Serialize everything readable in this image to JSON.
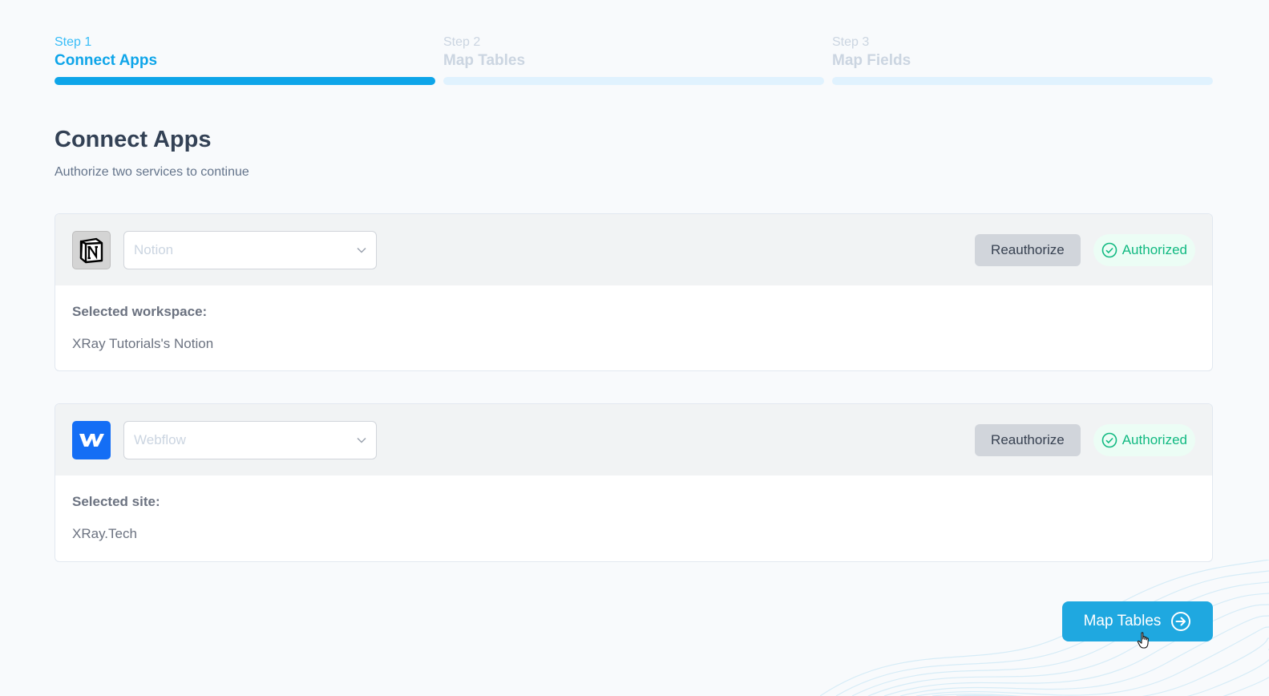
{
  "stepper": {
    "steps": [
      {
        "number": "Step 1",
        "title": "Connect Apps",
        "active": true
      },
      {
        "number": "Step 2",
        "title": "Map Tables",
        "active": false
      },
      {
        "number": "Step 3",
        "title": "Map Fields",
        "active": false
      }
    ]
  },
  "header": {
    "title": "Connect Apps",
    "subtitle": "Authorize two services to continue"
  },
  "apps": [
    {
      "icon": "notion-logo-icon",
      "placeholder": "Notion",
      "reauthorize_label": "Reauthorize",
      "status_label": "Authorized",
      "field_label": "Selected workspace:",
      "field_value": "XRay Tutorials's Notion"
    },
    {
      "icon": "webflow-logo-icon",
      "placeholder": "Webflow",
      "reauthorize_label": "Reauthorize",
      "status_label": "Authorized",
      "field_label": "Selected site:",
      "field_value": "XRay.Tech"
    }
  ],
  "footer": {
    "next_label": "Map Tables",
    "next_icon": "arrow-right-circle-icon"
  },
  "colors": {
    "accent": "#0ea5e9",
    "success": "#10b981",
    "button": "#1fa8e0"
  }
}
